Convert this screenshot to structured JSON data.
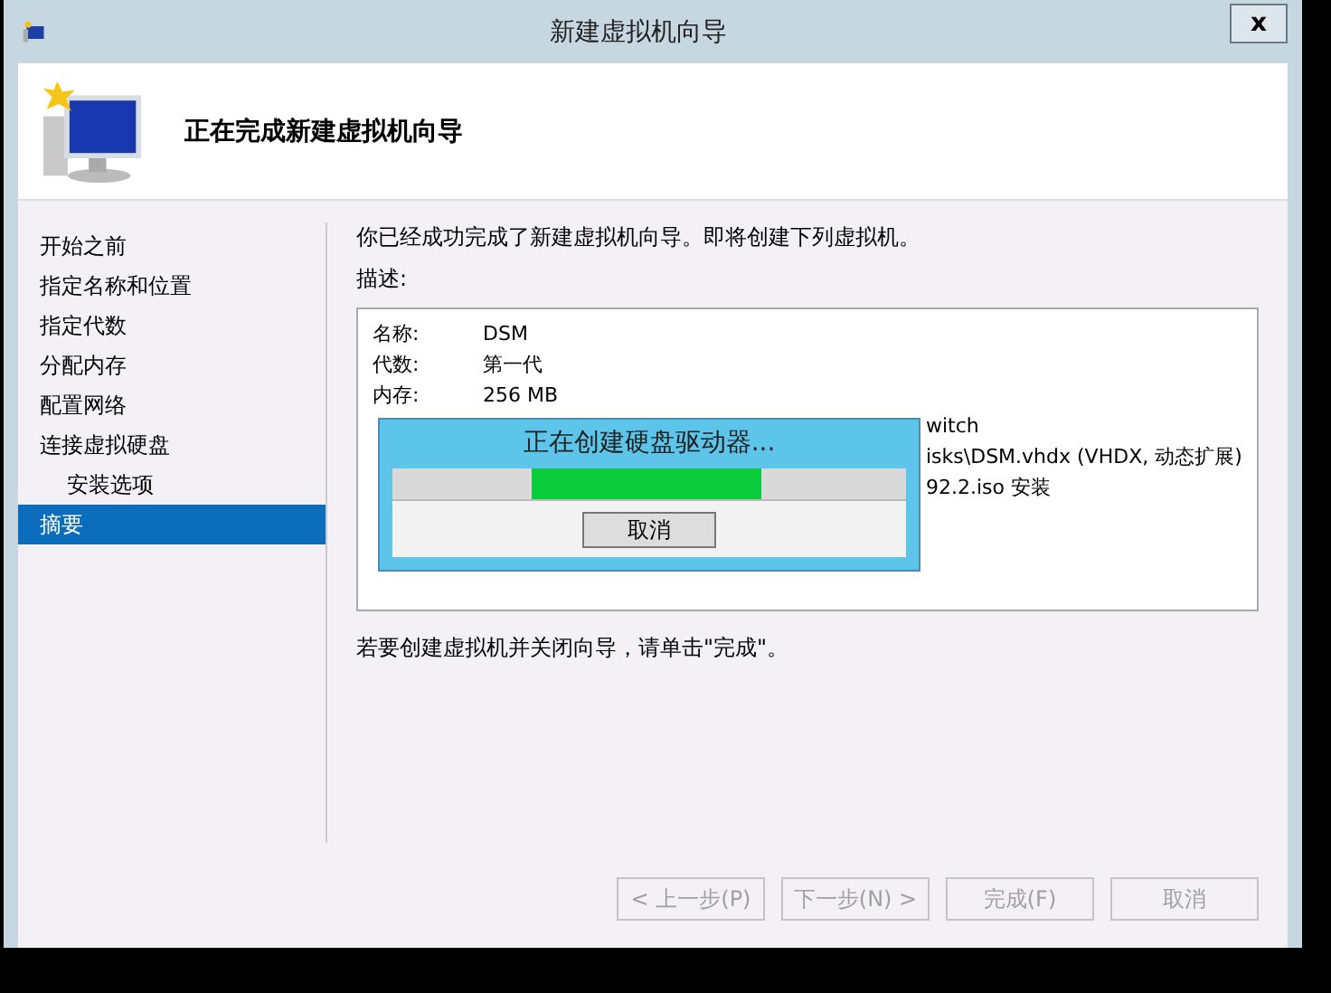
{
  "window": {
    "title": "新建虚拟机向导",
    "close": "x"
  },
  "header": {
    "title": "正在完成新建虚拟机向导"
  },
  "sidebar": {
    "items": [
      {
        "label": "开始之前",
        "selected": false
      },
      {
        "label": "指定名称和位置",
        "selected": false
      },
      {
        "label": "指定代数",
        "selected": false
      },
      {
        "label": "分配内存",
        "selected": false
      },
      {
        "label": "配置网络",
        "selected": false
      },
      {
        "label": "连接虚拟硬盘",
        "selected": false,
        "children": [
          {
            "label": "安装选项",
            "selected": false
          }
        ]
      },
      {
        "label": "摘要",
        "selected": true
      }
    ]
  },
  "content": {
    "intro": "你已经成功完成了新建虚拟机向导。即将创建下列虚拟机。",
    "description_label": "描述:",
    "summary": [
      {
        "label": "名称:",
        "value": "DSM"
      },
      {
        "label": "代数:",
        "value": "第一代"
      },
      {
        "label": "内存:",
        "value": "256 MB"
      },
      {
        "value": "witch"
      },
      {
        "value": "isks\\DSM.vhdx (VHDX, 动态扩展)"
      },
      {
        "value": "92.2.iso 安装"
      }
    ],
    "footer": "若要创建虚拟机并关闭向导，请单击\"完成\"。"
  },
  "progress_dialog": {
    "title": "正在创建硬盘驱动器...",
    "level": 0.45,
    "button": "取消"
  },
  "buttons": [
    {
      "label": "< 上一步(P)",
      "disabled": true
    },
    {
      "label": "下一步(N) >",
      "disabled": true
    },
    {
      "label": "完成(F)",
      "disabled": true
    },
    {
      "label": "取消",
      "disabled": true
    }
  ]
}
